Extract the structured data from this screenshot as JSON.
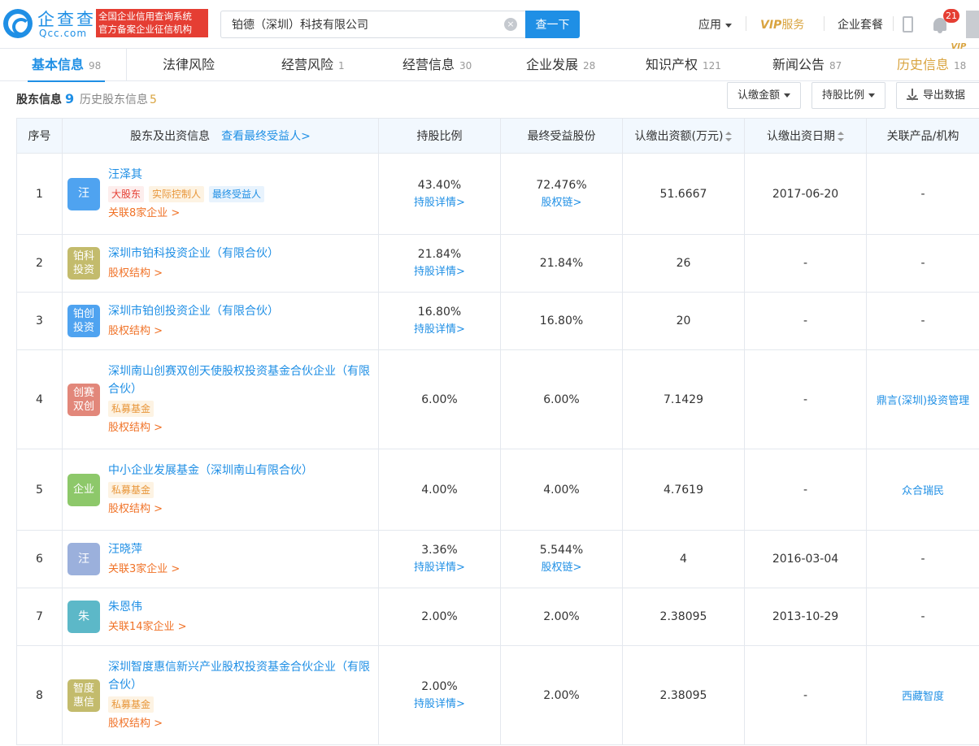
{
  "header": {
    "logo_cn": "企查查",
    "logo_en": "Qcc.com",
    "slogan_line1": "全国企业信用查询系统",
    "slogan_line2": "官方备案企业征信机构",
    "search_value": "铂德（深圳）科技有限公司",
    "search_clear": "×",
    "search_button": "查一下",
    "nav_apps": "应用",
    "nav_vip_mark": "VIP",
    "nav_vip_text": "服务",
    "nav_package": "企业套餐",
    "notification_count": "21"
  },
  "tabs": [
    {
      "label": "基本信息",
      "count": "98"
    },
    {
      "label": "法律风险",
      "count": ""
    },
    {
      "label": "经营风险",
      "count": "1"
    },
    {
      "label": "经营信息",
      "count": "30"
    },
    {
      "label": "企业发展",
      "count": "28"
    },
    {
      "label": "知识产权",
      "count": "121"
    },
    {
      "label": "新闻公告",
      "count": "87"
    },
    {
      "label": "历史信息",
      "count": "18",
      "badge": "VIP"
    }
  ],
  "section": {
    "title": "股东信息",
    "count": "9",
    "history_label": "历史股东信息",
    "history_count": "5",
    "btn_amount": "认缴金额",
    "btn_ratio": "持股比例",
    "btn_export": "导出数据"
  },
  "table": {
    "headers": {
      "index": "序号",
      "holder": "股东及出资信息",
      "holder_link": "查看最终受益人>",
      "ratio": "持股比例",
      "final_share": "最终受益股份",
      "amount": "认缴出资额(万元)",
      "date": "认缴出资日期",
      "product": "关联产品/机构"
    },
    "rows": [
      {
        "index": "1",
        "logo": "汪",
        "logo_color": "#4fa3f0",
        "name": "汪泽其",
        "tags": [
          {
            "text": "大股东",
            "style": "red"
          },
          {
            "text": "实际控制人",
            "style": "gold"
          },
          {
            "text": "最终受益人",
            "style": "blue"
          }
        ],
        "link": "关联8家企业 >",
        "ratio": "43.40%",
        "ratio_link": "持股详情>",
        "final": "72.476%",
        "final_link": "股权链>",
        "amount": "51.6667",
        "date": "2017-06-20",
        "product": "-"
      },
      {
        "index": "2",
        "logo": "铂科投资",
        "logo_color": "#c3bb6c",
        "name": "深圳市铂科投资企业（有限合伙）",
        "tags": [],
        "link": "股权结构 >",
        "ratio": "21.84%",
        "ratio_link": "持股详情>",
        "final": "21.84%",
        "final_link": "",
        "amount": "26",
        "date": "-",
        "product": "-"
      },
      {
        "index": "3",
        "logo": "铂创投资",
        "logo_color": "#4fa3f0",
        "name": "深圳市铂创投资企业（有限合伙）",
        "tags": [],
        "link": "股权结构 >",
        "ratio": "16.80%",
        "ratio_link": "持股详情>",
        "final": "16.80%",
        "final_link": "",
        "amount": "20",
        "date": "-",
        "product": "-"
      },
      {
        "index": "4",
        "logo": "创赛双创",
        "logo_color": "#e2877a",
        "name": "深圳南山创赛双创天使股权投资基金合伙企业（有限合伙）",
        "tags": [
          {
            "text": "私募基金",
            "style": "gold"
          }
        ],
        "link": "股权结构 >",
        "ratio": "6.00%",
        "ratio_link": "",
        "final": "6.00%",
        "final_link": "",
        "amount": "7.1429",
        "date": "-",
        "product": "鼎言(深圳)投资管理"
      },
      {
        "index": "5",
        "logo": "企业",
        "logo_color": "#8dc86a",
        "name": "中小企业发展基金（深圳南山有限合伙）",
        "tags": [
          {
            "text": "私募基金",
            "style": "gold"
          }
        ],
        "link": "股权结构 >",
        "ratio": "4.00%",
        "ratio_link": "",
        "final": "4.00%",
        "final_link": "",
        "amount": "4.7619",
        "date": "-",
        "product": "众合瑞民"
      },
      {
        "index": "6",
        "logo": "汪",
        "logo_color": "#9bb0dc",
        "name": "汪晓萍",
        "tags": [],
        "link": "关联3家企业 >",
        "ratio": "3.36%",
        "ratio_link": "持股详情>",
        "final": "5.544%",
        "final_link": "股权链>",
        "amount": "4",
        "date": "2016-03-04",
        "product": "-"
      },
      {
        "index": "7",
        "logo": "朱",
        "logo_color": "#5cb8c8",
        "name": "朱恩伟",
        "tags": [],
        "link": "关联14家企业 >",
        "ratio": "2.00%",
        "ratio_link": "",
        "final": "2.00%",
        "final_link": "",
        "amount": "2.38095",
        "date": "2013-10-29",
        "product": "-"
      },
      {
        "index": "8",
        "logo": "智度惠信",
        "logo_color": "#c3bb6c",
        "name": "深圳智度惠信新兴产业股权投资基金合伙企业（有限合伙）",
        "tags": [
          {
            "text": "私募基金",
            "style": "gold"
          }
        ],
        "link": "股权结构 >",
        "ratio": "2.00%",
        "ratio_link": "持股详情>",
        "final": "2.00%",
        "final_link": "",
        "amount": "2.38095",
        "date": "-",
        "product": "西藏智度"
      }
    ]
  }
}
